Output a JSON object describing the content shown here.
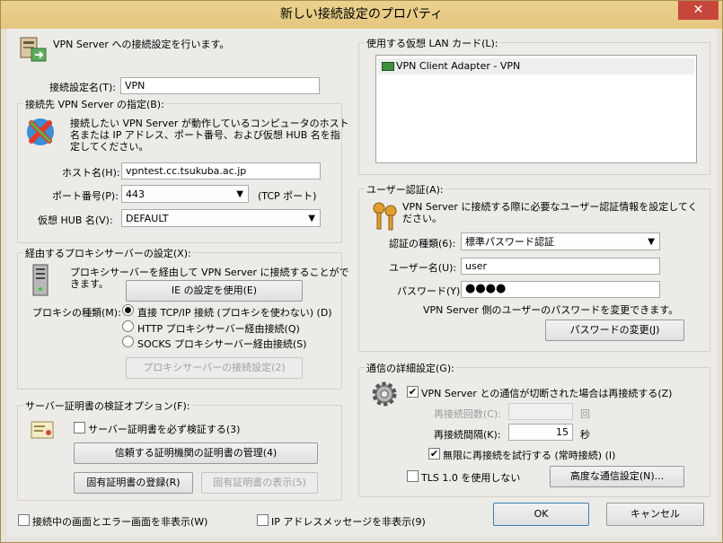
{
  "window": {
    "title": "新しい接続設定のプロパティ",
    "close_glyph": "✕"
  },
  "header": {
    "description": "VPN Server への接続設定を行います。"
  },
  "setting_name": {
    "label": "接続設定名(T):",
    "value": "VPN"
  },
  "target": {
    "group_label": "接続先 VPN Server の指定(B):",
    "description_line1": "接続したい VPN Server が動作しているコンピュータのホスト",
    "description_line2": "名または IP アドレス、ポート番号、および仮想 HUB 名を指",
    "description_line3": "定してください。",
    "host_label": "ホスト名(H):",
    "host_value": "vpntest.cc.tsukuba.ac.jp",
    "port_label": "ポート番号(P):",
    "port_value": "443",
    "port_note": "(TCP ポート)",
    "hub_label": "仮想 HUB 名(V):",
    "hub_value": "DEFAULT"
  },
  "proxy": {
    "group_label": "経由するプロキシサーバーの設定(X):",
    "description_line1": "プロキシサーバーを経由して VPN Server に接続することがで",
    "description_line2": "きます。",
    "ie_button": "IE の設定を使用(E)",
    "type_label": "プロキシの種類(M):",
    "option_direct": "直接 TCP/IP 接続 (プロキシを使わない) (D)",
    "option_http": "HTTP プロキシサーバー経由接続(Q)",
    "option_socks": "SOCKS プロキシサーバー経由接続(S)",
    "settings_button": "プロキシサーバーの接続設定(2)"
  },
  "cert": {
    "group_label": "サーバー証明書の検証オプション(F):",
    "verify_label": "サーバー証明書を必ず検証する(3)",
    "manage_button": "信頼する証明機関の証明書の管理(4)",
    "register_button": "固有証明書の登録(R)",
    "show_button": "固有証明書の表示(5)"
  },
  "bottom": {
    "hide_screens_label": "接続中の画面とエラー画面を非表示(W)",
    "hide_ip_label": "IP アドレスメッセージを非表示(9)",
    "ok": "OK",
    "cancel": "キャンセル"
  },
  "lan_card": {
    "group_label": "使用する仮想 LAN カード(L):",
    "items": [
      "VPN Client Adapter - VPN"
    ]
  },
  "auth": {
    "group_label": "ユーザー認証(A):",
    "description_line1": "VPN Server に接続する際に必要なユーザー認証情報を設定してく",
    "description_line2": "ださい。",
    "type_label": "認証の種類(6):",
    "type_value": "標準パスワード認証",
    "user_label": "ユーザー名(U):",
    "user_value": "user",
    "password_label": "パスワード(Y):",
    "password_value": "●●●●",
    "password_note": "VPN Server 側のユーザーのパスワードを変更できます。",
    "change_button": "パスワードの変更(J)"
  },
  "comm": {
    "group_label": "通信の詳細設定(G):",
    "reconnect_label": "VPN Server との通信が切断された場合は再接続する(Z)",
    "retry_count_label": "再接続回数(C):",
    "retry_count_unit": "回",
    "retry_interval_label": "再接続間隔(K):",
    "retry_interval_value": "15",
    "retry_interval_unit": "秒",
    "infinite_label": "無限に再接続を試行する (常時接続) (I)",
    "no_tls_label": "TLS 1.0 を使用しない",
    "advanced_button": "高度な通信設定(N)..."
  }
}
